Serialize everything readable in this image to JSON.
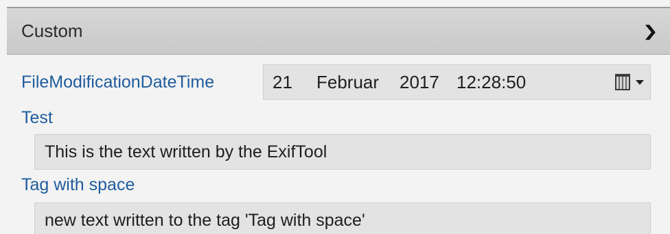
{
  "section": {
    "title": "Custom",
    "toggle_icon": "chevron-down-icon"
  },
  "properties": [
    {
      "label": "FileModificationDateTime",
      "type": "datetime",
      "value": {
        "day": "21",
        "month": "Februar",
        "year": "2017",
        "time": "12:28:50"
      },
      "picker_icon": "calendar-icon",
      "dropdown_icon": "caret-down-icon"
    },
    {
      "label": "Test",
      "type": "text",
      "value": "This is the text written by the ExifTool"
    },
    {
      "label": "Tag with space",
      "type": "text",
      "value": "new text written to the tag 'Tag with space'"
    }
  ],
  "colors": {
    "label": "#1f5c9c",
    "header_bg": "#cfcfcf",
    "field_bg": "#e3e3e3",
    "panel_bg": "#f3f3f3"
  }
}
